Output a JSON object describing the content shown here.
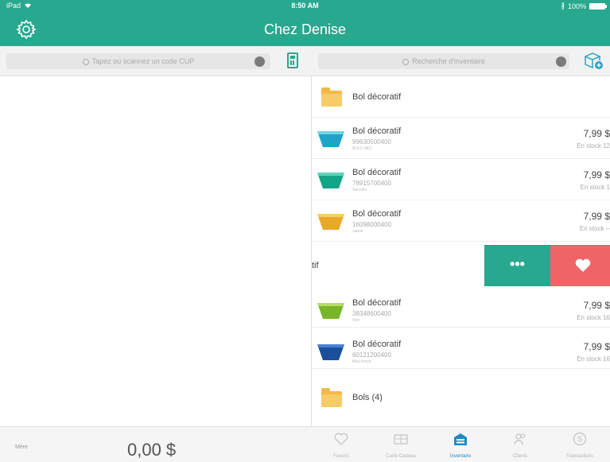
{
  "status_bar": {
    "device": "iPad",
    "time": "8:50 AM",
    "battery": "100%"
  },
  "header": {
    "title": "Chez Denise"
  },
  "search": {
    "left_placeholder": "Tapez ou scannez un code CUP",
    "right_placeholder": "Recherche d'inventaire"
  },
  "inventory": {
    "folder_top": "Bol décoratif",
    "items": [
      {
        "name": "Bol décoratif",
        "sku": "99630500400",
        "variant": "BLEU SKU",
        "price": "7,99 $",
        "stock": "En stock 12",
        "color": "#1fa3c7",
        "rim": "#6fd3e8"
      },
      {
        "name": "Bol décoratif",
        "sku": "78915700400",
        "variant": "Sarcelle",
        "price": "7,99 $",
        "stock": "En stock 1",
        "color": "#14a587",
        "rim": "#5fd4b9"
      },
      {
        "name": "Bol décoratif",
        "sku": "16098000400",
        "variant": "Jaune",
        "price": "7,99 $",
        "stock": "En stock --",
        "color": "#e8a92a",
        "rim": "#f6cd6b"
      }
    ],
    "swiped_text": "tif",
    "swipe_more": "•••",
    "items_after": [
      {
        "name": "Bol décoratif",
        "sku": "38348600400",
        "variant": "Vert",
        "price": "7,99 $",
        "stock": "En stock 16",
        "color": "#79b52a",
        "rim": "#b6de65"
      },
      {
        "name": "Bol décoratif",
        "sku": "60121200400",
        "variant": "Bleu foncé",
        "price": "7,99 $",
        "stock": "En stock 16",
        "color": "#1b4f9c",
        "rim": "#4a7fd0"
      }
    ],
    "folder_bottom": "Bols (4)"
  },
  "sale": {
    "more_label": "Mère",
    "total": "0,00 $"
  },
  "tabs": [
    {
      "label": "Favoris"
    },
    {
      "label": "Carte-Cadeau"
    },
    {
      "label": "Inventaire"
    },
    {
      "label": "Clients"
    },
    {
      "label": "Transactions"
    }
  ],
  "colors": {
    "brand": "#27a88f",
    "favorite": "#ef6466",
    "active_tab": "#1e8bc3"
  }
}
